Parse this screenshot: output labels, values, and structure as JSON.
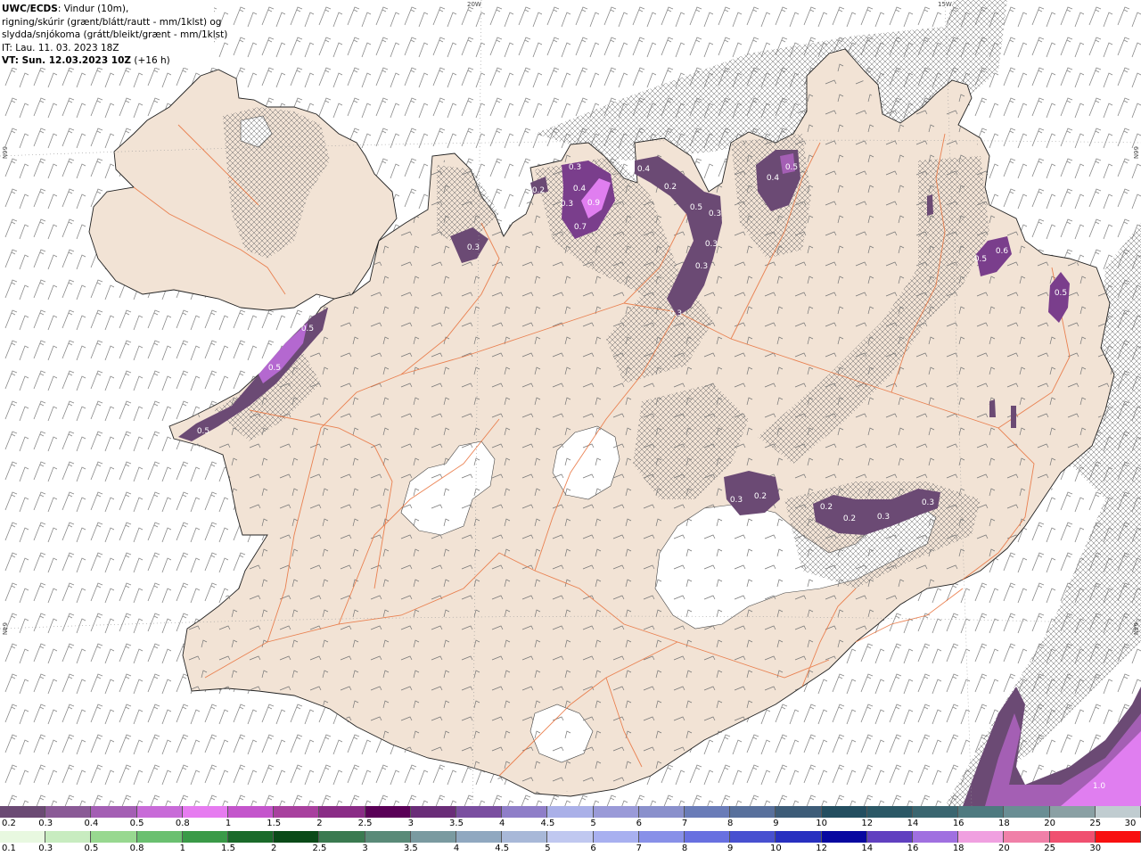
{
  "header": {
    "line1_bold": "UWC/ECDS",
    "line1_rest": ": Vindur (10m),",
    "line2": "rigning/skúrir (grænt/blátt/rautt - mm/1klst) og",
    "line3": "slydda/snjókoma (grátt/bleikt/grænt - mm/1klst)",
    "line4": "IT: Lau. 11. 03. 2023 18Z",
    "line5_bold": "VT: Sun. 12.03.2023 10Z",
    "line5_rest": " (+16 h)"
  },
  "grid_labels": {
    "top_20w": "20W",
    "top_15w": "15W",
    "left_66n": "66N",
    "right_66n": "66N",
    "left_64n": "64N",
    "right_64n": "64N"
  },
  "precip_labels": [
    {
      "text": "0.5"
    },
    {
      "text": "0.5"
    },
    {
      "text": "0.5"
    },
    {
      "text": "0.3"
    },
    {
      "text": "0.2"
    },
    {
      "text": "0.3"
    },
    {
      "text": "0.4"
    },
    {
      "text": "0.3"
    },
    {
      "text": "0.9"
    },
    {
      "text": "0.7"
    },
    {
      "text": "0.4"
    },
    {
      "text": "0.2"
    },
    {
      "text": "0.5"
    },
    {
      "text": "0.3"
    },
    {
      "text": "0.3"
    },
    {
      "text": "0.3"
    },
    {
      "text": "0.3"
    },
    {
      "text": "0.4"
    },
    {
      "text": "0.5"
    },
    {
      "text": "0.5"
    },
    {
      "text": "0.6"
    },
    {
      "text": "0.5"
    },
    {
      "text": "0.3"
    },
    {
      "text": "0.2"
    },
    {
      "text": "0.2"
    },
    {
      "text": "0.2"
    },
    {
      "text": "0.3"
    },
    {
      "text": "0.3"
    },
    {
      "text": "1.0"
    }
  ],
  "colorscale_snow": {
    "ticks": [
      "0.2",
      "0.3",
      "0.4",
      "0.5",
      "0.8",
      "1",
      "1.5",
      "2",
      "2.5",
      "3",
      "3.5",
      "4",
      "4.5",
      "5",
      "6",
      "7",
      "8",
      "9",
      "10",
      "12",
      "14",
      "16",
      "18",
      "20",
      "25",
      "30"
    ],
    "colors": [
      "#6b4a74",
      "#8a5a96",
      "#a45fb4",
      "#c86bd8",
      "#e67cf0",
      "#c455cc",
      "#a8409e",
      "#8a2c86",
      "#5a0057",
      "#6a2d78",
      "#7a4ea0",
      "#8f7ec8",
      "#aab0e8",
      "#9a9ad8",
      "#8a90cc",
      "#6a7cb8",
      "#58709c",
      "#3d5c78",
      "#234e60",
      "#2b5866",
      "#3a6670",
      "#4e7a80",
      "#6a8e94",
      "#8aa0a4",
      "#c0ccd0"
    ]
  },
  "colorscale_rain": {
    "ticks": [
      "0.1",
      "0.3",
      "0.5",
      "0.8",
      "1",
      "1.5",
      "2",
      "2.5",
      "3",
      "3.5",
      "4",
      "4.5",
      "5",
      "6",
      "7",
      "8",
      "9",
      "10",
      "12",
      "14",
      "16",
      "18",
      "20",
      "25",
      "30"
    ],
    "colors": [
      "#e8f8e0",
      "#c8ecc0",
      "#98d890",
      "#6ac070",
      "#3a9a48",
      "#1a6a2a",
      "#0a4a18",
      "#3a7a50",
      "#5a8a78",
      "#7a9aa0",
      "#90a8c0",
      "#a8b8d8",
      "#c0c8f0",
      "#a8b0f0",
      "#8890e8",
      "#6870e0",
      "#4850d0",
      "#2830c0",
      "#0808a0",
      "#6040c0",
      "#a070e0",
      "#f0a0e0",
      "#f080a8",
      "#f05070",
      "#f81010"
    ]
  },
  "colors": {
    "land": "#f2e3d5",
    "sea": "#ffffff",
    "glacier": "#ffffff",
    "roads": "#e8703a",
    "precip_light": "#6b4a74",
    "precip_mid": "#9a55b0",
    "precip_high": "#e07ef0"
  }
}
